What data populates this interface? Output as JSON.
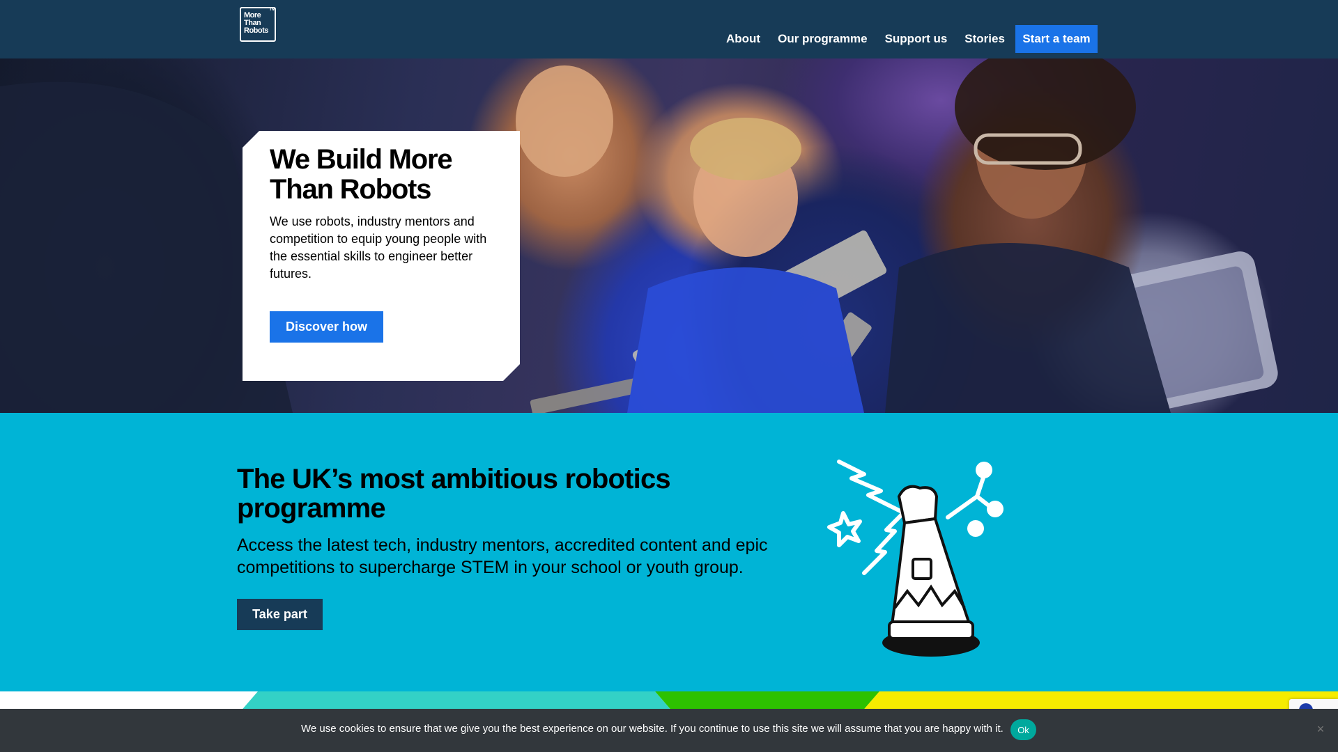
{
  "header": {
    "logo_lines": [
      "More",
      "Than",
      "Robots"
    ],
    "logo_tm": "TM",
    "nav": [
      {
        "label": "About"
      },
      {
        "label": "Our programme"
      },
      {
        "label": "Support us"
      },
      {
        "label": "Stories"
      }
    ],
    "cta_label": "Start a team"
  },
  "hero": {
    "title": "We Build More Than Robots",
    "text": "We use robots, industry mentors and competition to equip young people with the essential skills to engineer better futures.",
    "button_label": "Discover how"
  },
  "intro": {
    "title": "The UK’s most ambitious robotics programme",
    "text": "Access the latest tech, industry mentors, accredited content and epic competitions to supercharge STEM in your school or youth group.",
    "button_label": "Take part"
  },
  "stripes": {
    "colors": [
      "#ffffff",
      "#33d1c6",
      "#2dc100",
      "#f6ec00"
    ]
  },
  "cookie_bar": {
    "text": "We use cookies to ensure that we give you the best experience on our website. If you continue to use this site we will assume that you are happy with it.",
    "ok_label": "Ok",
    "close_icon": "×"
  },
  "colors": {
    "header_bg": "#173b57",
    "accent_blue": "#1a73e8",
    "section_cyan": "#00b4d6",
    "cookie_bg": "#32373c",
    "cookie_ok": "#00a99d"
  }
}
